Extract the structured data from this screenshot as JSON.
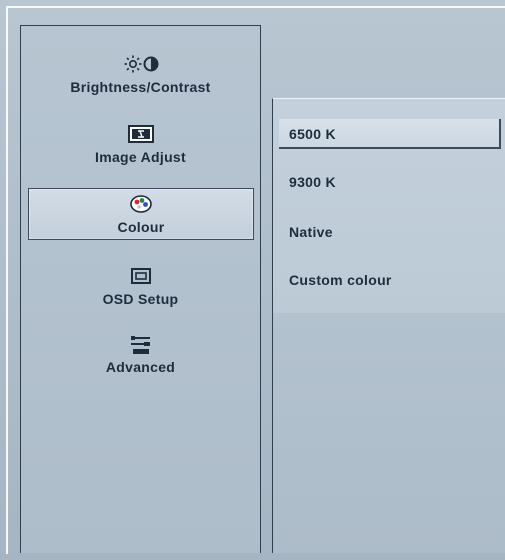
{
  "menu": {
    "items": [
      {
        "label": "Brightness/Contrast",
        "icon": "brightness-contrast-icon",
        "selected": false
      },
      {
        "label": "Image Adjust",
        "icon": "image-adjust-icon",
        "selected": false
      },
      {
        "label": "Colour",
        "icon": "colour-palette-icon",
        "selected": true
      },
      {
        "label": "OSD Setup",
        "icon": "osd-setup-icon",
        "selected": false
      },
      {
        "label": "Advanced",
        "icon": "advanced-settings-icon",
        "selected": false
      }
    ]
  },
  "submenu": {
    "options": [
      {
        "label": "6500 K",
        "selected": true
      },
      {
        "label": "9300 K",
        "selected": false
      },
      {
        "label": "Native",
        "selected": false
      },
      {
        "label": "Custom colour",
        "selected": false
      }
    ]
  },
  "colors": {
    "text": "#1d2d3e",
    "background": "#b7c4d0",
    "border": "#2e3f52",
    "highlight": "#d2dce6"
  }
}
